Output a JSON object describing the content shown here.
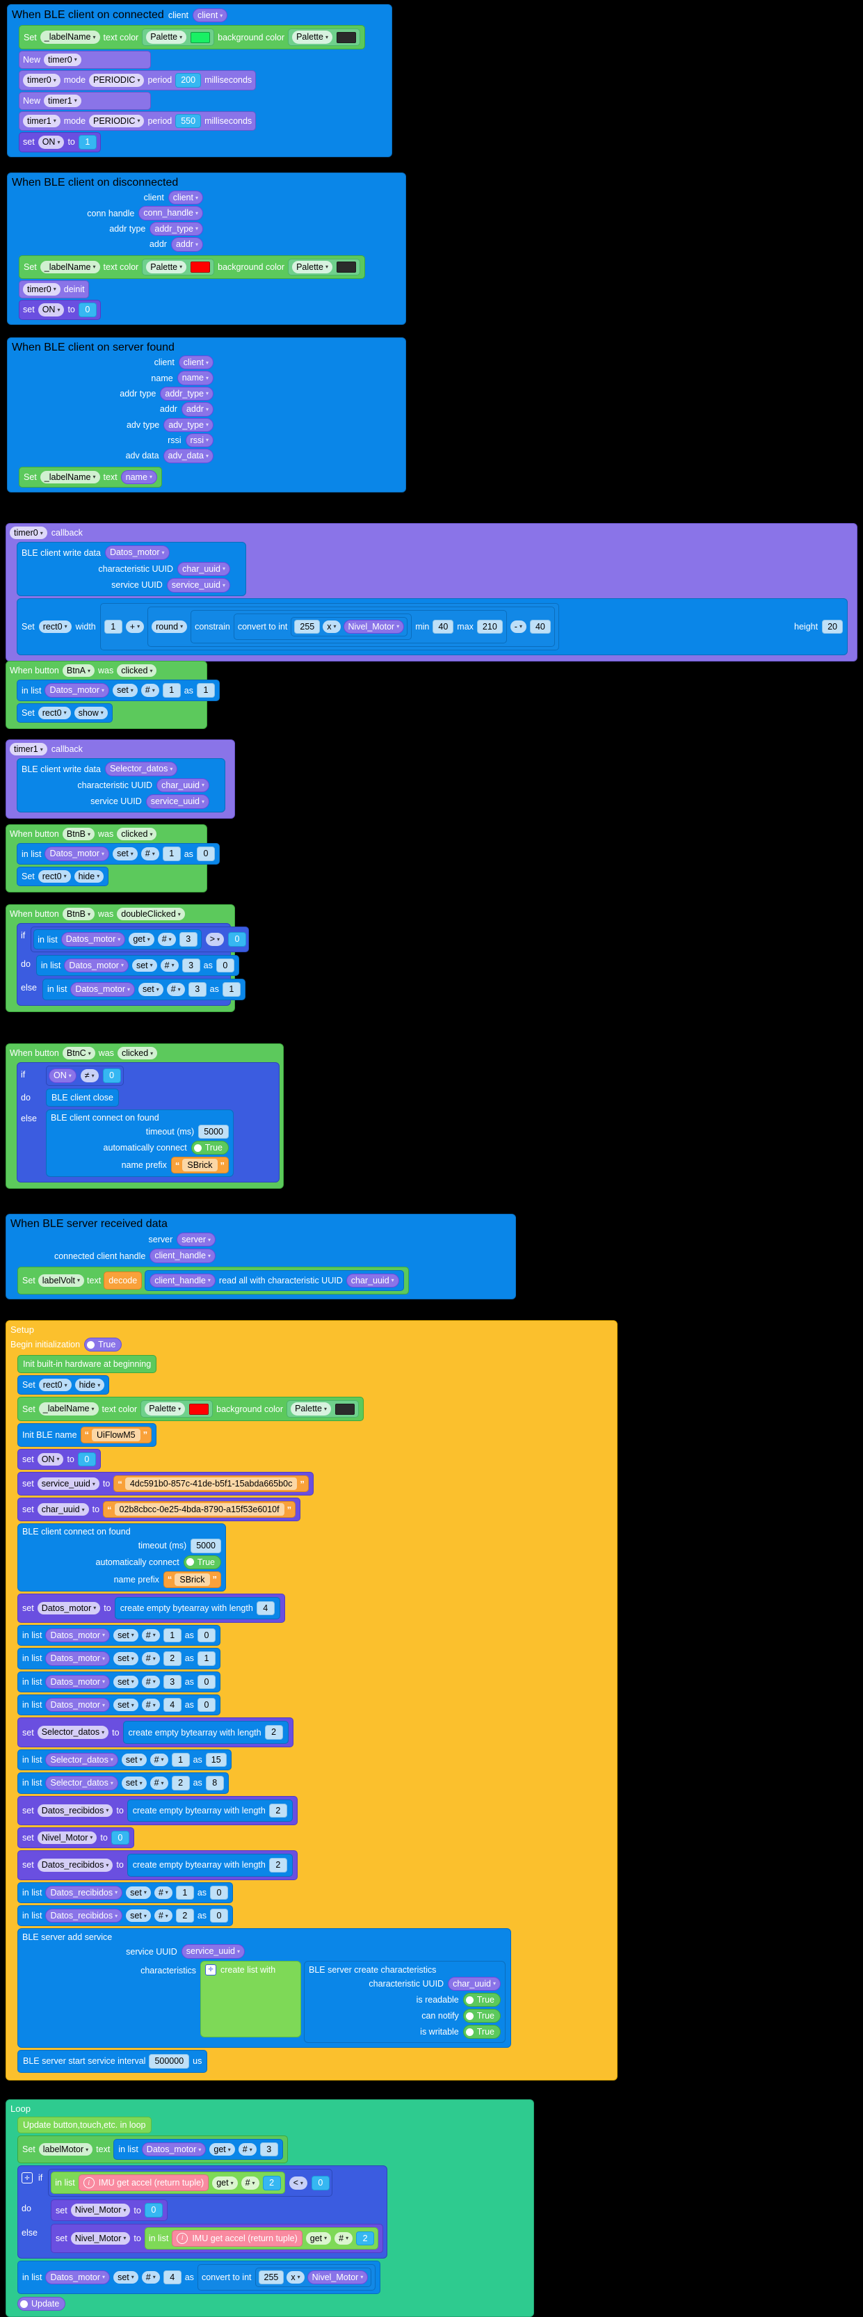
{
  "meta": {
    "app": "UIFlow Blockly workspace",
    "background": "#000000"
  },
  "labels": {
    "client": "client",
    "conn_handle": "conn_handle",
    "addr_type": "addr_type",
    "addr": "addr",
    "name": "name",
    "adv_type": "adv_type",
    "rssi": "rssi",
    "adv_data": "adv_data",
    "server": "server",
    "client_handle": "client_handle",
    "char_uuid": "char_uuid",
    "service_uuid": "service_uuid",
    "set": "set",
    "get": "get",
    "as": "as",
    "to": "to",
    "text": "text",
    "in_list": "in list",
    "hash": "#",
    "if": "if",
    "do": "do",
    "else": "else",
    "callback": "callback",
    "mode": "mode",
    "period": "period",
    "milliseconds": "milliseconds",
    "deinit": "deinit",
    "new": "New",
    "width": "width",
    "height": "height",
    "min": "min",
    "max": "max",
    "constrain": "constrain",
    "convert_to_int": "convert to int",
    "round": "round",
    "timeout_ms": "timeout (ms)",
    "automatically_connect": "automatically connect",
    "name_prefix": "name prefix",
    "text_color": "text color",
    "background_color": "background color",
    "palette": "Palette",
    "Set": "Set",
    "set_lc": "set",
    "true": "True",
    "us": "us",
    "create_list_with": "create list with",
    "characteristics": "characteristics",
    "was": "was"
  },
  "blocks": {
    "on_connected": {
      "title": "When BLE client on connected",
      "args": [
        {
          "name": "client",
          "value": "client"
        }
      ],
      "set_label_color": {
        "prefix": "Set",
        "var": "_labelName",
        "text_color_label": "text color",
        "text_color_mode": "Palette",
        "text_color_hex": "#19f064",
        "bg_color_label": "background color",
        "bg_color_mode": "Palette",
        "bg_color_hex": "#2b2b2b"
      },
      "new_timer0": {
        "prefix": "New",
        "timer": "timer0"
      },
      "timer0_mode": {
        "timer": "timer0",
        "mode_label": "mode",
        "mode": "PERIODIC",
        "period_label": "period",
        "period": "200",
        "unit": "milliseconds"
      },
      "new_timer1": {
        "prefix": "New",
        "timer": "timer1"
      },
      "timer1_mode": {
        "timer": "timer1",
        "mode_label": "mode",
        "mode": "PERIODIC",
        "period_label": "period",
        "period": "550",
        "unit": "milliseconds"
      },
      "set_on": {
        "prefix": "set",
        "var": "ON",
        "to": "to",
        "value": "1"
      }
    },
    "on_disconnected": {
      "title": "When BLE client on disconnected",
      "args": [
        {
          "name": "client",
          "value": "client"
        },
        {
          "name": "conn handle",
          "value": "conn_handle"
        },
        {
          "name": "addr type",
          "value": "addr_type"
        },
        {
          "name": "addr",
          "value": "addr"
        }
      ],
      "set_label_color": {
        "prefix": "Set",
        "var": "_labelName",
        "text_color_label": "text color",
        "text_color_mode": "Palette",
        "text_color_hex": "#ff0000",
        "bg_color_label": "background color",
        "bg_color_mode": "Palette",
        "bg_color_hex": "#2b2b2b"
      },
      "timer_deinit": {
        "timer": "timer0",
        "action": "deinit"
      },
      "set_on": {
        "prefix": "set",
        "var": "ON",
        "to": "to",
        "value": "0"
      }
    },
    "on_server_found": {
      "title": "When BLE client on server found",
      "args": [
        {
          "name": "client",
          "value": "client"
        },
        {
          "name": "name",
          "value": "name"
        },
        {
          "name": "addr type",
          "value": "addr_type"
        },
        {
          "name": "addr",
          "value": "addr"
        },
        {
          "name": "adv type",
          "value": "adv_type"
        },
        {
          "name": "rssi",
          "value": "rssi"
        },
        {
          "name": "adv data",
          "value": "adv_data"
        }
      ],
      "set_label_text": {
        "prefix": "Set",
        "var": "_labelName",
        "field": "text",
        "value": "name"
      }
    },
    "timer0_callback": {
      "title_var": "timer0",
      "title": "callback",
      "write_data": {
        "label": "BLE client write data",
        "value": "Datos_motor",
        "char_label": "characteristic UUID",
        "char_value": "char_uuid",
        "service_label": "service UUID",
        "service_value": "service_uuid"
      },
      "set_rect": {
        "prefix": "Set",
        "target": "rect0",
        "width_label": "width",
        "base": "1",
        "op": "+",
        "round": "round",
        "constrain": "constrain",
        "convert": "convert to int",
        "factor": "255",
        "mul": "x",
        "variable": "Nivel_Motor",
        "min_label": "min",
        "min": "40",
        "max_label": "max",
        "max": "210",
        "minus": "-",
        "offset": "40",
        "height_label": "height",
        "height": "20"
      }
    },
    "btnA_clicked": {
      "title_prefix": "When button",
      "button": "BtnA",
      "was": "was",
      "event": "clicked",
      "in_list": {
        "label": "in list",
        "list": "Datos_motor",
        "op": "set",
        "hash": "#",
        "index": "1",
        "as": "as",
        "value": "1"
      },
      "set_rect": {
        "prefix": "Set",
        "target": "rect0",
        "action": "show"
      }
    },
    "timer1_callback": {
      "title_var": "timer1",
      "title": "callback",
      "write_data": {
        "label": "BLE client write data",
        "value": "Selector_datos",
        "char_label": "characteristic UUID",
        "char_value": "char_uuid",
        "service_label": "service UUID",
        "service_value": "service_uuid"
      }
    },
    "btnB_clicked": {
      "title_prefix": "When button",
      "button": "BtnB",
      "was": "was",
      "event": "clicked",
      "in_list": {
        "label": "in list",
        "list": "Datos_motor",
        "op": "set",
        "hash": "#",
        "index": "1",
        "as": "as",
        "value": "0"
      },
      "set_rect": {
        "prefix": "Set",
        "target": "rect0",
        "action": "hide"
      }
    },
    "btnB_double": {
      "title_prefix": "When button",
      "button": "BtnB",
      "was": "was",
      "event": "doubleClicked",
      "if_label": "if",
      "cond": {
        "label": "in list",
        "list": "Datos_motor",
        "op": "get",
        "hash": "#",
        "index": "3",
        "cmp": ">",
        "rhs": "0"
      },
      "do_label": "do",
      "do": {
        "label": "in list",
        "list": "Datos_motor",
        "op": "set",
        "hash": "#",
        "index": "3",
        "as": "as",
        "value": "0"
      },
      "else_label": "else",
      "else": {
        "label": "in list",
        "list": "Datos_motor",
        "op": "set",
        "hash": "#",
        "index": "3",
        "as": "as",
        "value": "1"
      }
    },
    "btnC_clicked": {
      "title_prefix": "When button",
      "button": "BtnC",
      "was": "was",
      "event": "clicked",
      "if_label": "if",
      "cond": {
        "var": "ON",
        "cmp": "≠",
        "rhs": "0"
      },
      "do_label": "do",
      "do": {
        "label": "BLE client close"
      },
      "else_label": "else",
      "else": {
        "label": "BLE client connect on found",
        "timeout_label": "timeout (ms)",
        "timeout": "5000",
        "auto_label": "automatically connect",
        "auto": "True",
        "prefix_label": "name prefix",
        "prefix": "SBrick"
      }
    },
    "server_received": {
      "title": "When BLE server received data",
      "args": [
        {
          "name": "server",
          "value": "server"
        },
        {
          "name": "connected client handle",
          "value": "client_handle"
        }
      ],
      "set_label": {
        "prefix": "Set",
        "var": "labelVolt",
        "field": "text",
        "decode": "decode",
        "handle": "client_handle",
        "read_label": "read all with characteristic UUID",
        "char": "char_uuid"
      }
    },
    "setup": {
      "title": "Setup",
      "begin_label": "Begin initialization",
      "begin_value": "True",
      "init_hw": "Init built-in hardware at beginning",
      "set_rect_hide": {
        "prefix": "Set",
        "target": "rect0",
        "action": "hide"
      },
      "set_label_color": {
        "prefix": "Set",
        "var": "_labelName",
        "text_color_label": "text color",
        "text_color_mode": "Palette",
        "text_color_hex": "#ff0000",
        "bg_color_label": "background color",
        "bg_color_mode": "Palette",
        "bg_color_hex": "#2b2b2b"
      },
      "init_ble": {
        "label": "Init BLE name",
        "value": "UiFlowM5"
      },
      "set_on": {
        "prefix": "set",
        "var": "ON",
        "to": "to",
        "value": "0"
      },
      "set_service_uuid": {
        "prefix": "set",
        "var": "service_uuid",
        "to": "to",
        "value": "4dc591b0-857c-41de-b5f1-15abda665b0c"
      },
      "set_char_uuid": {
        "prefix": "set",
        "var": "char_uuid",
        "to": "to",
        "value": "02b8cbcc-0e25-4bda-8790-a15f53e6010f"
      },
      "connect_on_found": {
        "label": "BLE client connect on found",
        "timeout_label": "timeout (ms)",
        "timeout": "5000",
        "auto_label": "automatically connect",
        "auto": "True",
        "prefix_label": "name prefix",
        "prefix": "SBrick"
      },
      "set_datos_motor": {
        "prefix": "set",
        "var": "Datos_motor",
        "to": "to",
        "label": "create empty bytearray with length",
        "length": "4"
      },
      "datos_motor_items": [
        {
          "label": "in list",
          "list": "Datos_motor",
          "op": "set",
          "hash": "#",
          "index": "1",
          "as": "as",
          "value": "0"
        },
        {
          "label": "in list",
          "list": "Datos_motor",
          "op": "set",
          "hash": "#",
          "index": "2",
          "as": "as",
          "value": "1"
        },
        {
          "label": "in list",
          "list": "Datos_motor",
          "op": "set",
          "hash": "#",
          "index": "3",
          "as": "as",
          "value": "0"
        },
        {
          "label": "in list",
          "list": "Datos_motor",
          "op": "set",
          "hash": "#",
          "index": "4",
          "as": "as",
          "value": "0"
        }
      ],
      "set_selector": {
        "prefix": "set",
        "var": "Selector_datos",
        "to": "to",
        "label": "create empty bytearray with length",
        "length": "2"
      },
      "selector_items": [
        {
          "label": "in list",
          "list": "Selector_datos",
          "op": "set",
          "hash": "#",
          "index": "1",
          "as": "as",
          "value": "15"
        },
        {
          "label": "in list",
          "list": "Selector_datos",
          "op": "set",
          "hash": "#",
          "index": "2",
          "as": "as",
          "value": "8"
        }
      ],
      "set_recibidos_1": {
        "prefix": "set",
        "var": "Datos_recibidos",
        "to": "to",
        "label": "create empty bytearray with length",
        "length": "2"
      },
      "set_nivel": {
        "prefix": "set",
        "var": "Nivel_Motor",
        "to": "to",
        "value": "0"
      },
      "set_recibidos_2": {
        "prefix": "set",
        "var": "Datos_recibidos",
        "to": "to",
        "label": "create empty bytearray with length",
        "length": "2"
      },
      "recibidos_items": [
        {
          "label": "in list",
          "list": "Datos_recibidos",
          "op": "set",
          "hash": "#",
          "index": "1",
          "as": "as",
          "value": "0"
        },
        {
          "label": "in list",
          "list": "Datos_recibidos",
          "op": "set",
          "hash": "#",
          "index": "2",
          "as": "as",
          "value": "0"
        }
      ],
      "add_service": {
        "label": "BLE server add service",
        "service_label": "service UUID",
        "service_value": "service_uuid",
        "char_label": "characteristics",
        "create_list": "create list with",
        "create_char": "BLE server create characteristics",
        "char_uuid_label": "characteristic UUID",
        "char_uuid_value": "char_uuid",
        "readable_label": "is readable",
        "readable": "True",
        "notify_label": "can notify",
        "notify": "True",
        "writable_label": "is writable",
        "writable": "True"
      },
      "start_service": {
        "label": "BLE server start service interval",
        "value": "500000",
        "unit": "us"
      }
    },
    "loop": {
      "title": "Loop",
      "update_label": "Update button,touch,etc. in loop",
      "set_label_motor": {
        "prefix": "Set",
        "var": "labelMotor",
        "field": "text",
        "list_label": "in list",
        "list": "Datos_motor",
        "op": "get",
        "hash": "#",
        "index": "3"
      },
      "if_label": "if",
      "cond": {
        "list_label": "in list",
        "imu": "IMU get accel (return tuple)",
        "op": "get",
        "hash": "#",
        "index": "2",
        "cmp": "<",
        "rhs": "0"
      },
      "do_label": "do",
      "do": {
        "prefix": "set",
        "var": "Nivel_Motor",
        "to": "to",
        "value": "0"
      },
      "else_label": "else",
      "else": {
        "prefix": "set",
        "var": "Nivel_Motor",
        "to": "to",
        "list_label": "in list",
        "imu": "IMU get accel (return tuple)",
        "op": "get",
        "hash": "#",
        "index": "2"
      },
      "final": {
        "label": "in list",
        "list": "Datos_motor",
        "op": "set",
        "hash": "#",
        "index": "4",
        "as": "as",
        "convert": "convert to int",
        "factor": "255",
        "mul": "x",
        "variable": "Nivel_Motor"
      },
      "update_toggle": "Update"
    }
  }
}
